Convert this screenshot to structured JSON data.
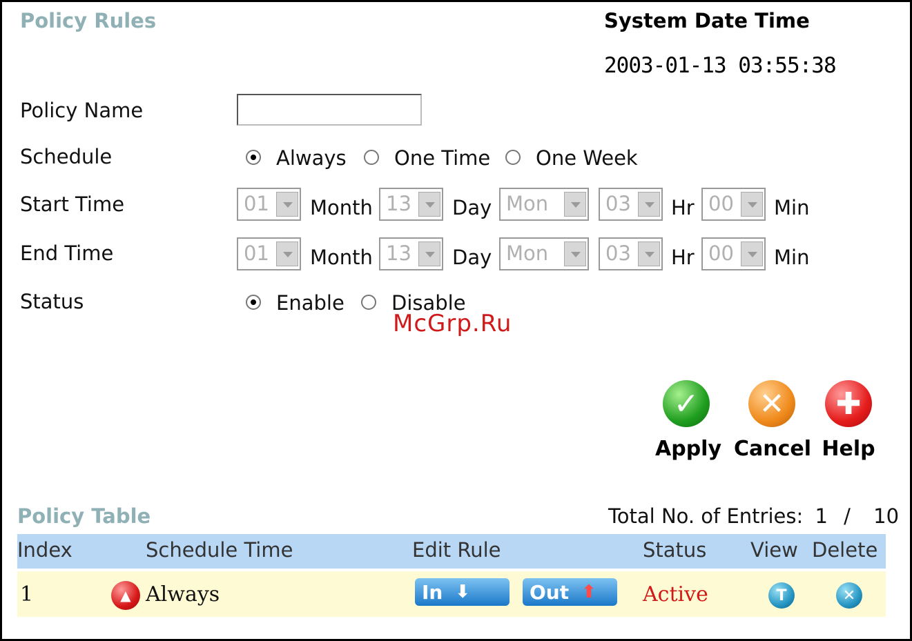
{
  "header": {
    "title": "Policy Rules",
    "system_date_time_label": "System Date Time",
    "system_date_time_value": "2003-01-13 03:55:38"
  },
  "form": {
    "policy_name": {
      "label": "Policy Name",
      "value": ""
    },
    "schedule": {
      "label": "Schedule",
      "options": [
        "Always",
        "One Time",
        "One Week"
      ],
      "selected": "Always"
    },
    "start_time": {
      "label": "Start Time",
      "month": "01",
      "month_unit": "Month",
      "day": "13",
      "day_unit": "Day",
      "weekday": "Mon",
      "hour": "03",
      "hour_unit": "Hr",
      "minute": "00",
      "minute_unit": "Min"
    },
    "end_time": {
      "label": "End Time",
      "month": "01",
      "month_unit": "Month",
      "day": "13",
      "day_unit": "Day",
      "weekday": "Mon",
      "hour": "03",
      "hour_unit": "Hr",
      "minute": "00",
      "minute_unit": "Min"
    },
    "status": {
      "label": "Status",
      "options": [
        "Enable",
        "Disable"
      ],
      "selected": "Enable"
    }
  },
  "watermark": "McGrp.Ru",
  "actions": {
    "apply": {
      "label": "Apply",
      "icon": "checkmark-icon"
    },
    "cancel": {
      "label": "Cancel",
      "icon": "x-icon"
    },
    "help": {
      "label": "Help",
      "icon": "plus-icon"
    }
  },
  "policy_table": {
    "title": "Policy Table",
    "entries_label": "Total No. of Entries:",
    "entries_count": "1",
    "entries_sep": "/",
    "entries_max": "10",
    "columns": [
      "Index",
      "Schedule Time",
      "Edit Rule",
      "Status",
      "View",
      "Delete"
    ],
    "rows": [
      {
        "index": "1",
        "schedule_time": "Always",
        "edit_in_label": "In",
        "edit_out_label": "Out",
        "status": "Active"
      }
    ]
  },
  "colors": {
    "section_title": "#8fb0b4",
    "table_header_bg": "#b8d7f4",
    "table_row_bg": "#fefbd4",
    "status_active": "#d21919",
    "watermark": "#d01a1a"
  }
}
